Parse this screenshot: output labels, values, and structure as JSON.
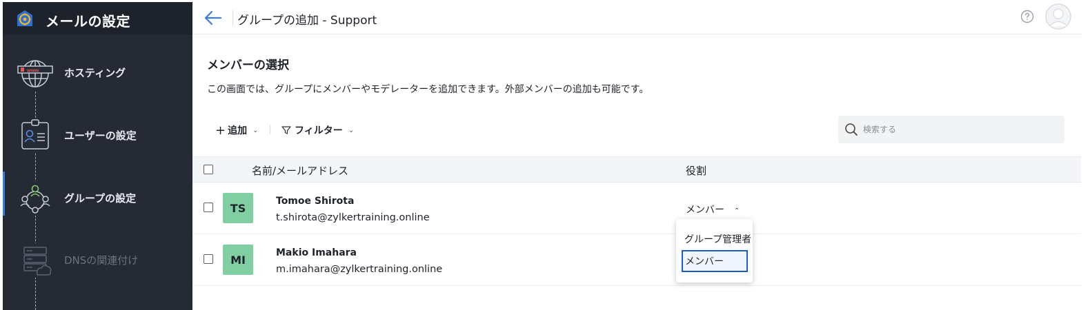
{
  "colors": {
    "sidebar_bg": "#252a35",
    "accent": "#1a5bc4",
    "avatar_green": "#7fcfa3"
  },
  "sidebar": {
    "app_title": "メールの設定",
    "logo_icon": "mail-settings-logo-icon",
    "steps": [
      {
        "label": "ホスティング",
        "icon": "globe-www-icon",
        "state": "done"
      },
      {
        "label": "ユーザーの設定",
        "icon": "id-card-icon",
        "state": "done"
      },
      {
        "label": "グループの設定",
        "icon": "group-network-icon",
        "state": "active"
      },
      {
        "label": "DNSの関連付け",
        "icon": "dns-server-icon",
        "state": "disabled"
      }
    ]
  },
  "header": {
    "back_icon": "arrow-left-icon",
    "title": "グループの追加 - Support",
    "help_icon": "help-circle-icon",
    "avatar_icon": "user-avatar-icon"
  },
  "section": {
    "title": "メンバーの選択",
    "description": "この画面では、グループにメンバーやモデレーターを追加できます。外部メンバーの追加も可能です。"
  },
  "toolbar": {
    "add_label": "追加",
    "filter_label": "フィルター",
    "search_placeholder": "検索する"
  },
  "table": {
    "columns": [
      "名前/メールアドレス",
      "役割"
    ],
    "rows": [
      {
        "initials": "TS",
        "name": "Tomoe Shirota",
        "email": "t.shirota@zylkertraining.online",
        "role": "メンバー"
      },
      {
        "initials": "MI",
        "name": "Makio Imahara",
        "email": "m.imahara@zylkertraining.online",
        "role": ""
      }
    ]
  },
  "role_dropdown": {
    "options": [
      "グループ管理者",
      "メンバー"
    ],
    "selected": "メンバー"
  }
}
